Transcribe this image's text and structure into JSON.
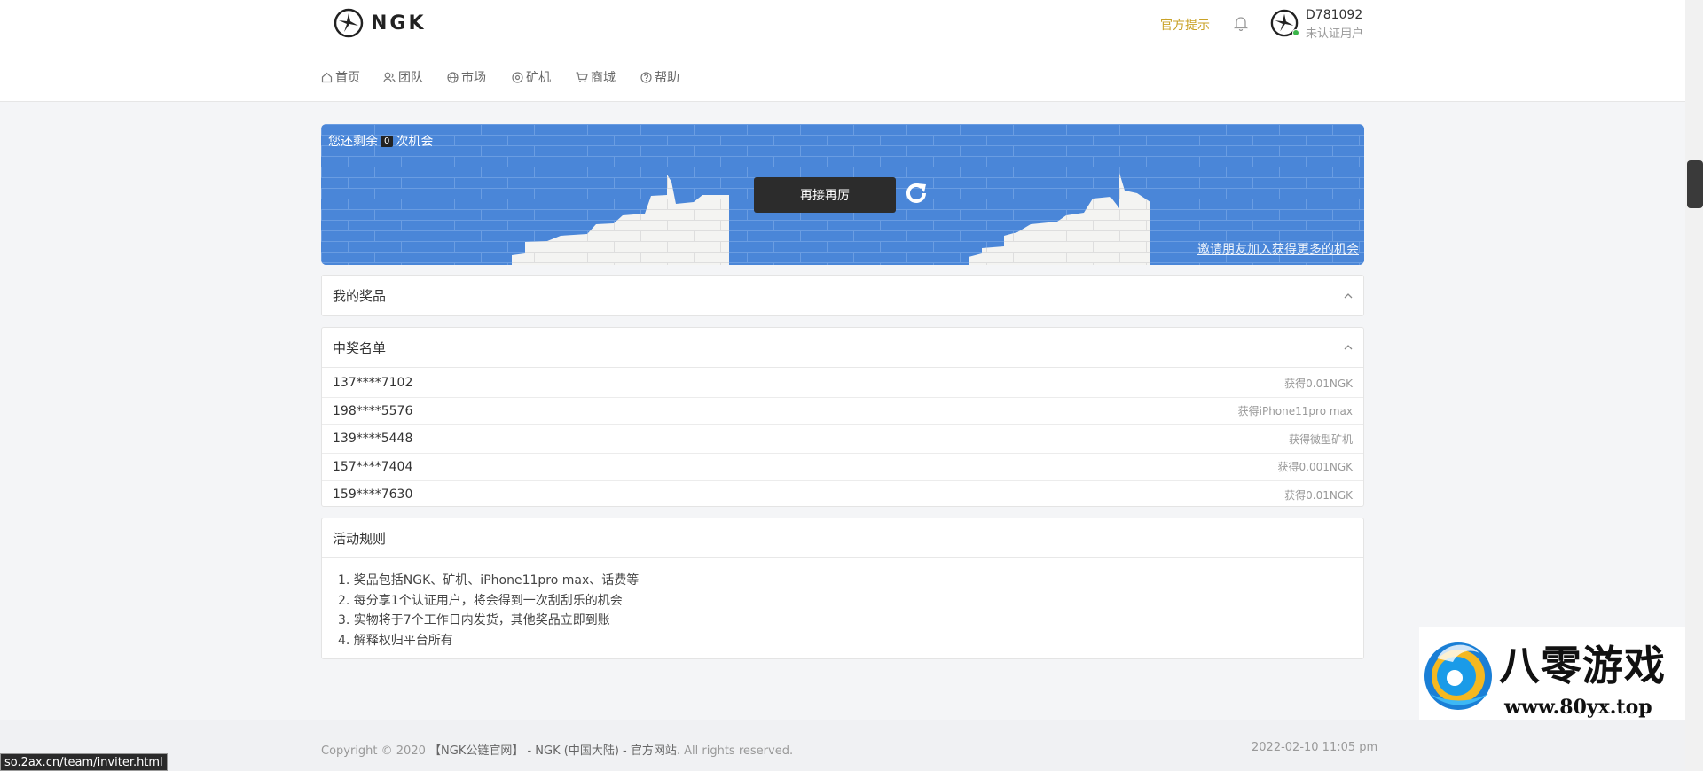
{
  "header": {
    "logo_text": "NGK",
    "notice": "官方提示",
    "user": {
      "id": "D781092",
      "status": "未认证用户"
    }
  },
  "nav": [
    {
      "label": "首页",
      "icon": "home-icon"
    },
    {
      "label": "团队",
      "icon": "team-icon"
    },
    {
      "label": "市场",
      "icon": "globe-icon"
    },
    {
      "label": "矿机",
      "icon": "miner-icon"
    },
    {
      "label": "商城",
      "icon": "cart-icon"
    },
    {
      "label": "帮助",
      "icon": "help-icon"
    }
  ],
  "scratch": {
    "chances_prefix": "您还剩余",
    "chances_count": "0",
    "chances_suffix": "次机会",
    "retry_label": "再接再厉",
    "invite_link": "邀请朋友加入获得更多的机会"
  },
  "my_prizes": {
    "title": "我的奖品"
  },
  "winners": {
    "title": "中奖名单",
    "rows": [
      {
        "user": "137****7102",
        "prize": "获得0.01NGK"
      },
      {
        "user": "198****5576",
        "prize": "获得iPhone11pro max"
      },
      {
        "user": "139****5448",
        "prize": "获得微型矿机"
      },
      {
        "user": "157****7404",
        "prize": "获得0.001NGK"
      },
      {
        "user": "159****7630",
        "prize": "获得0.01NGK"
      }
    ]
  },
  "rules": {
    "title": "活动规则",
    "items": [
      "1. 奖品包括NGK、矿机、iPhone11pro max、话费等",
      "2. 每分享1个认证用户，将会得到一次刮刮乐的机会",
      "3. 实物将于7个工作日内发货，其他奖品立即到账",
      "4. 解释权归平台所有"
    ]
  },
  "footer": {
    "copyright_prefix": "Copyright © 2020",
    "copyright_site": "【NGK公链官网】 - NGK (中国大陆) - 官方网站",
    "copyright_suffix": ". All rights reserved.",
    "time": "2022-02-10 11:05 pm"
  },
  "status_url": "so.2ax.cn/team/inviter.html",
  "watermark": {
    "title": "八零游戏",
    "url": "www.80yx.top"
  },
  "colors": {
    "accent_notice": "#c9a227",
    "scratch_blue": "#4a86d8",
    "online": "#3bb54a"
  }
}
